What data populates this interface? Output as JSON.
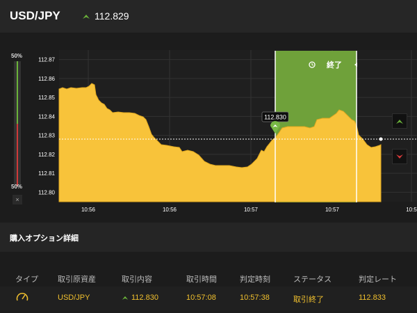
{
  "header": {
    "pair": "USD/JPY",
    "price": "112.829",
    "direction_icon": "up-arrow-icon",
    "up_color": "#6bb33a"
  },
  "gauge": {
    "top_label": "50%",
    "bottom_label": "50%",
    "close_label": "×",
    "up_share": 0.5,
    "down_share": 0.5
  },
  "chart_data": {
    "type": "area",
    "y_ticks": [
      "112.87",
      "112.86",
      "112.85",
      "112.84",
      "112.83",
      "112.82",
      "112.81",
      "112.80"
    ],
    "x_ticks": [
      "10:56",
      "10:56",
      "10:57",
      "10:57",
      "10:5"
    ],
    "ylim": [
      112.795,
      112.875
    ],
    "current_rate": "112.829",
    "entry_label": "112.830",
    "expiry_label": "終了",
    "fill_color": "#f8c33a",
    "window_color": "#6fa13a",
    "grid": true
  },
  "side_buttons": {
    "high_icon": "up-arrow-icon",
    "low_icon": "down-arrow-icon",
    "high_color": "#6bb33a",
    "low_color": "#d83a3a"
  },
  "details": {
    "title": "購入オプション詳細"
  },
  "table": {
    "headers": [
      "タイプ",
      "取引原資産",
      "取引内容",
      "取引時間",
      "判定時刻",
      "ステータス",
      "判定レート"
    ],
    "row": {
      "type_icon": "gauge-icon",
      "asset": "USD/JPY",
      "trade_rate": "112.830",
      "trade_time": "10:57:08",
      "judge_time": "10:57:38",
      "status": "取引終了",
      "judge_rate": "112.833"
    }
  }
}
